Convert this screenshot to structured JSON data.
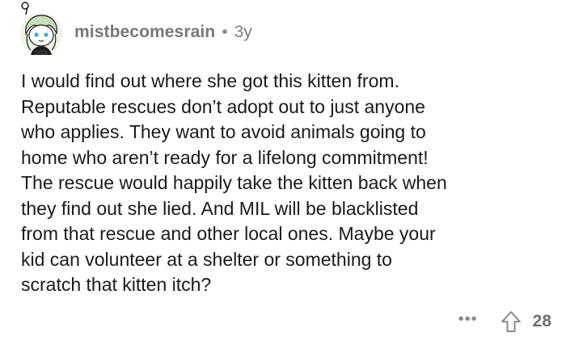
{
  "comment": {
    "author": "mistbecomesrain",
    "separator": "•",
    "age": "3y",
    "body_lines": [
      "I would find out where she got this kitten from.",
      "Reputable rescues don’t adopt out to just anyone",
      "who applies. They want to avoid animals going to",
      "home who aren’t ready for a lifelong commitment!",
      "The rescue would happily take the kitten back when",
      "they find out she lied. And MIL will be blacklisted",
      "from that rescue and other local ones. Maybe your",
      "kid can volunteer at a shelter or something to",
      "scratch that kitten itch?"
    ],
    "more_label": "•••",
    "score": "28"
  },
  "icons": {
    "avatar": "avatar-icon",
    "more": "more-options-icon",
    "upvote": "upvote-arrow-icon"
  },
  "colors": {
    "text": "#1a1a1b",
    "meta": "#7c7c7c",
    "avatar_accent": "#c9ddbe"
  }
}
